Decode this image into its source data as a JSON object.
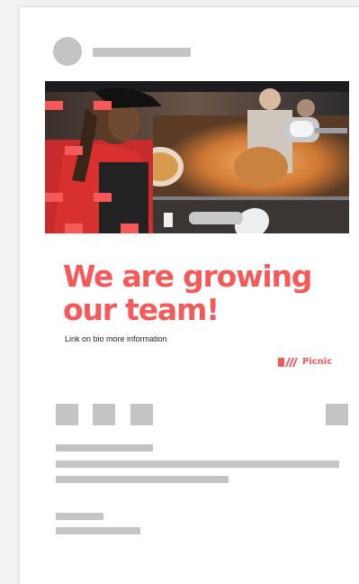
{
  "post": {
    "headline_line1": "We are growing",
    "headline_line2": "our team!",
    "subtext": "Link on bio more information",
    "brand_name": "Picnic",
    "accent_color": "#f55a5a",
    "placeholder_color": "#c4c4c4"
  },
  "icons": {
    "brand_logo": "stripes-logo-icon"
  }
}
